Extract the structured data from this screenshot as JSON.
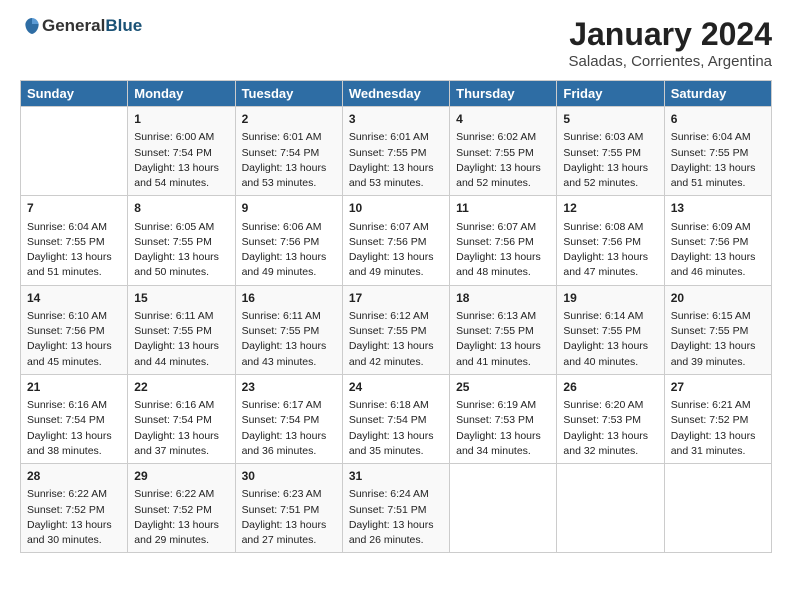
{
  "header": {
    "logo_general": "General",
    "logo_blue": "Blue",
    "title": "January 2024",
    "subtitle": "Saladas, Corrientes, Argentina"
  },
  "days_of_week": [
    "Sunday",
    "Monday",
    "Tuesday",
    "Wednesday",
    "Thursday",
    "Friday",
    "Saturday"
  ],
  "weeks": [
    [
      {
        "day": "",
        "sunrise": "",
        "sunset": "",
        "daylight": ""
      },
      {
        "day": "1",
        "sunrise": "Sunrise: 6:00 AM",
        "sunset": "Sunset: 7:54 PM",
        "daylight": "Daylight: 13 hours and 54 minutes."
      },
      {
        "day": "2",
        "sunrise": "Sunrise: 6:01 AM",
        "sunset": "Sunset: 7:54 PM",
        "daylight": "Daylight: 13 hours and 53 minutes."
      },
      {
        "day": "3",
        "sunrise": "Sunrise: 6:01 AM",
        "sunset": "Sunset: 7:55 PM",
        "daylight": "Daylight: 13 hours and 53 minutes."
      },
      {
        "day": "4",
        "sunrise": "Sunrise: 6:02 AM",
        "sunset": "Sunset: 7:55 PM",
        "daylight": "Daylight: 13 hours and 52 minutes."
      },
      {
        "day": "5",
        "sunrise": "Sunrise: 6:03 AM",
        "sunset": "Sunset: 7:55 PM",
        "daylight": "Daylight: 13 hours and 52 minutes."
      },
      {
        "day": "6",
        "sunrise": "Sunrise: 6:04 AM",
        "sunset": "Sunset: 7:55 PM",
        "daylight": "Daylight: 13 hours and 51 minutes."
      }
    ],
    [
      {
        "day": "7",
        "sunrise": "Sunrise: 6:04 AM",
        "sunset": "Sunset: 7:55 PM",
        "daylight": "Daylight: 13 hours and 51 minutes."
      },
      {
        "day": "8",
        "sunrise": "Sunrise: 6:05 AM",
        "sunset": "Sunset: 7:55 PM",
        "daylight": "Daylight: 13 hours and 50 minutes."
      },
      {
        "day": "9",
        "sunrise": "Sunrise: 6:06 AM",
        "sunset": "Sunset: 7:56 PM",
        "daylight": "Daylight: 13 hours and 49 minutes."
      },
      {
        "day": "10",
        "sunrise": "Sunrise: 6:07 AM",
        "sunset": "Sunset: 7:56 PM",
        "daylight": "Daylight: 13 hours and 49 minutes."
      },
      {
        "day": "11",
        "sunrise": "Sunrise: 6:07 AM",
        "sunset": "Sunset: 7:56 PM",
        "daylight": "Daylight: 13 hours and 48 minutes."
      },
      {
        "day": "12",
        "sunrise": "Sunrise: 6:08 AM",
        "sunset": "Sunset: 7:56 PM",
        "daylight": "Daylight: 13 hours and 47 minutes."
      },
      {
        "day": "13",
        "sunrise": "Sunrise: 6:09 AM",
        "sunset": "Sunset: 7:56 PM",
        "daylight": "Daylight: 13 hours and 46 minutes."
      }
    ],
    [
      {
        "day": "14",
        "sunrise": "Sunrise: 6:10 AM",
        "sunset": "Sunset: 7:56 PM",
        "daylight": "Daylight: 13 hours and 45 minutes."
      },
      {
        "day": "15",
        "sunrise": "Sunrise: 6:11 AM",
        "sunset": "Sunset: 7:55 PM",
        "daylight": "Daylight: 13 hours and 44 minutes."
      },
      {
        "day": "16",
        "sunrise": "Sunrise: 6:11 AM",
        "sunset": "Sunset: 7:55 PM",
        "daylight": "Daylight: 13 hours and 43 minutes."
      },
      {
        "day": "17",
        "sunrise": "Sunrise: 6:12 AM",
        "sunset": "Sunset: 7:55 PM",
        "daylight": "Daylight: 13 hours and 42 minutes."
      },
      {
        "day": "18",
        "sunrise": "Sunrise: 6:13 AM",
        "sunset": "Sunset: 7:55 PM",
        "daylight": "Daylight: 13 hours and 41 minutes."
      },
      {
        "day": "19",
        "sunrise": "Sunrise: 6:14 AM",
        "sunset": "Sunset: 7:55 PM",
        "daylight": "Daylight: 13 hours and 40 minutes."
      },
      {
        "day": "20",
        "sunrise": "Sunrise: 6:15 AM",
        "sunset": "Sunset: 7:55 PM",
        "daylight": "Daylight: 13 hours and 39 minutes."
      }
    ],
    [
      {
        "day": "21",
        "sunrise": "Sunrise: 6:16 AM",
        "sunset": "Sunset: 7:54 PM",
        "daylight": "Daylight: 13 hours and 38 minutes."
      },
      {
        "day": "22",
        "sunrise": "Sunrise: 6:16 AM",
        "sunset": "Sunset: 7:54 PM",
        "daylight": "Daylight: 13 hours and 37 minutes."
      },
      {
        "day": "23",
        "sunrise": "Sunrise: 6:17 AM",
        "sunset": "Sunset: 7:54 PM",
        "daylight": "Daylight: 13 hours and 36 minutes."
      },
      {
        "day": "24",
        "sunrise": "Sunrise: 6:18 AM",
        "sunset": "Sunset: 7:54 PM",
        "daylight": "Daylight: 13 hours and 35 minutes."
      },
      {
        "day": "25",
        "sunrise": "Sunrise: 6:19 AM",
        "sunset": "Sunset: 7:53 PM",
        "daylight": "Daylight: 13 hours and 34 minutes."
      },
      {
        "day": "26",
        "sunrise": "Sunrise: 6:20 AM",
        "sunset": "Sunset: 7:53 PM",
        "daylight": "Daylight: 13 hours and 32 minutes."
      },
      {
        "day": "27",
        "sunrise": "Sunrise: 6:21 AM",
        "sunset": "Sunset: 7:52 PM",
        "daylight": "Daylight: 13 hours and 31 minutes."
      }
    ],
    [
      {
        "day": "28",
        "sunrise": "Sunrise: 6:22 AM",
        "sunset": "Sunset: 7:52 PM",
        "daylight": "Daylight: 13 hours and 30 minutes."
      },
      {
        "day": "29",
        "sunrise": "Sunrise: 6:22 AM",
        "sunset": "Sunset: 7:52 PM",
        "daylight": "Daylight: 13 hours and 29 minutes."
      },
      {
        "day": "30",
        "sunrise": "Sunrise: 6:23 AM",
        "sunset": "Sunset: 7:51 PM",
        "daylight": "Daylight: 13 hours and 27 minutes."
      },
      {
        "day": "31",
        "sunrise": "Sunrise: 6:24 AM",
        "sunset": "Sunset: 7:51 PM",
        "daylight": "Daylight: 13 hours and 26 minutes."
      },
      {
        "day": "",
        "sunrise": "",
        "sunset": "",
        "daylight": ""
      },
      {
        "day": "",
        "sunrise": "",
        "sunset": "",
        "daylight": ""
      },
      {
        "day": "",
        "sunrise": "",
        "sunset": "",
        "daylight": ""
      }
    ]
  ]
}
